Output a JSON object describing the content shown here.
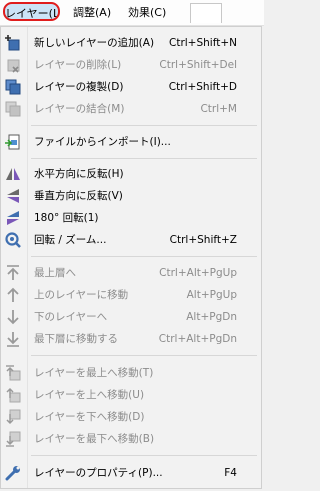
{
  "menubar": {
    "layer": "レイヤー(L)",
    "adjust": "調整(A)",
    "effect": "効果(C)"
  },
  "menu": {
    "items": [
      {
        "label": "新しいレイヤーの追加(A)",
        "shortcut": "Ctrl+Shift+N",
        "enabled": true,
        "icon": "add-layer-icon"
      },
      {
        "label": "レイヤーの削除(L)",
        "shortcut": "Ctrl+Shift+Del",
        "enabled": false,
        "icon": "delete-layer-icon"
      },
      {
        "label": "レイヤーの複製(D)",
        "shortcut": "Ctrl+Shift+D",
        "enabled": true,
        "icon": "duplicate-layer-icon"
      },
      {
        "label": "レイヤーの結合(M)",
        "shortcut": "Ctrl+M",
        "enabled": false,
        "icon": "merge-layer-icon"
      },
      {
        "label": "ファイルからインポート(I)...",
        "shortcut": "",
        "enabled": true,
        "icon": "import-file-icon"
      },
      {
        "label": "水平方向に反転(H)",
        "shortcut": "",
        "enabled": true,
        "icon": "flip-horizontal-icon"
      },
      {
        "label": "垂直方向に反転(V)",
        "shortcut": "",
        "enabled": true,
        "icon": "flip-vertical-icon"
      },
      {
        "label": "180° 回転(1)",
        "shortcut": "",
        "enabled": true,
        "icon": "rotate-180-icon"
      },
      {
        "label": "回転 / ズーム...",
        "shortcut": "Ctrl+Shift+Z",
        "enabled": true,
        "icon": "rotate-zoom-icon"
      },
      {
        "label": "最上層へ",
        "shortcut": "Ctrl+Alt+PgUp",
        "enabled": false,
        "icon": "move-to-top-icon"
      },
      {
        "label": "上のレイヤーに移動",
        "shortcut": "Alt+PgUp",
        "enabled": false,
        "icon": "move-up-icon"
      },
      {
        "label": "下のレイヤーへ",
        "shortcut": "Alt+PgDn",
        "enabled": false,
        "icon": "move-down-icon"
      },
      {
        "label": "最下層に移動する",
        "shortcut": "Ctrl+Alt+PgDn",
        "enabled": false,
        "icon": "move-to-bottom-icon"
      },
      {
        "label": "レイヤーを最上へ移動(T)",
        "shortcut": "",
        "enabled": false,
        "icon": "layer-to-top-icon"
      },
      {
        "label": "レイヤーを上へ移動(U)",
        "shortcut": "",
        "enabled": false,
        "icon": "layer-up-icon"
      },
      {
        "label": "レイヤーを下へ移動(D)",
        "shortcut": "",
        "enabled": false,
        "icon": "layer-down-icon"
      },
      {
        "label": "レイヤーを最下へ移動(B)",
        "shortcut": "",
        "enabled": false,
        "icon": "layer-to-bottom-icon"
      },
      {
        "label": "レイヤーのプロパティ(P)...",
        "shortcut": "F4",
        "enabled": true,
        "icon": "wrench-icon"
      }
    ]
  },
  "colors": {
    "highlight_ring": "#e01d1d",
    "menu_background": "#f2f2f2",
    "disabled_text": "#8c8c8c"
  }
}
